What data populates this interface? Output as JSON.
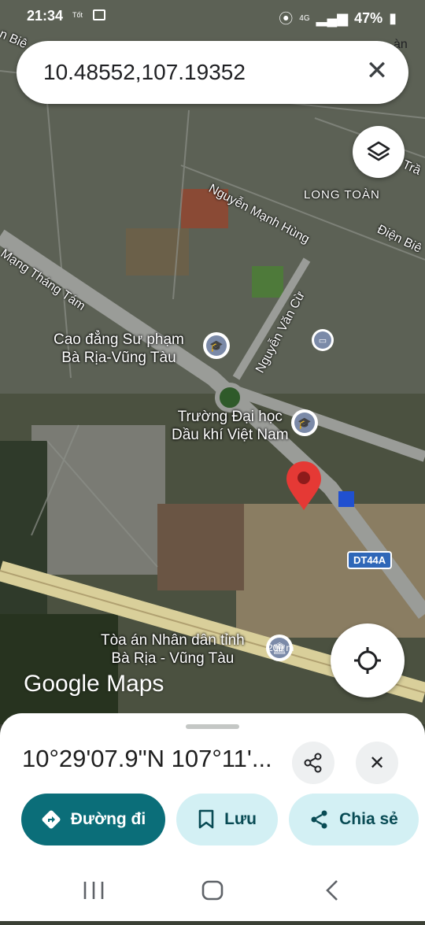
{
  "status_bar": {
    "time": "21:34",
    "carrier": "Tốt",
    "network": "4G",
    "battery": "47%"
  },
  "search": {
    "query": "10.48552,107.19352"
  },
  "map_labels": {
    "college": "Cao đẳng Sư phạm\nBà Rịa-Vũng Tàu",
    "university": "Trường Đại học\nDầu khí Việt Nam",
    "court": "Tòa án Nhân dân tỉnh\nBà Rịa - Vũng Tàu",
    "district": "LONG TOÀN",
    "road_nmh": "Nguyễn Mạnh Hùng",
    "road_cmtt": "Mạng Tháng Tám",
    "road_nvc": "Nguyễn Văn Cừ",
    "road_db": "Điện Biê",
    "road_tr": "Trầ",
    "road_bie": "n Biê",
    "road_an": "àn",
    "highway_shield": "DT44A",
    "scale": "200 m"
  },
  "branding": {
    "logo": "Google Maps"
  },
  "sheet": {
    "coordinates": "10°29'07.9\"N 107°11'...",
    "directions_label": "Đường đi",
    "save_label": "Lưu",
    "share_label": "Chia sẻ"
  },
  "colors": {
    "accent": "#0b6e79",
    "pin": "#e53935"
  },
  "icons": [
    "close-icon",
    "layers-icon",
    "my-location-icon",
    "share-icon",
    "bookmark-icon",
    "directions-icon",
    "school-icon",
    "bus-icon",
    "courthouse-icon"
  ]
}
